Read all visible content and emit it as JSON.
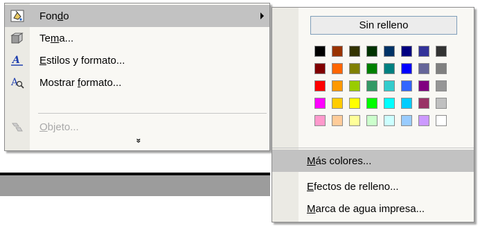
{
  "menu": {
    "items": [
      {
        "pre": "Fon",
        "u": "d",
        "post": "o",
        "icon": "paint-bucket-icon",
        "enabled": true,
        "highlighted": true,
        "has_submenu": true
      },
      {
        "pre": "Te",
        "u": "m",
        "post": "a...",
        "icon": "theme-icon",
        "enabled": true
      },
      {
        "pre": "",
        "u": "E",
        "post": "stilos y formato...",
        "icon": "styles-icon",
        "enabled": true
      },
      {
        "pre": "Mostrar ",
        "u": "f",
        "post": "ormato...",
        "icon": "reveal-formatting-icon",
        "enabled": true
      },
      {
        "pre": "",
        "u": "O",
        "post": "bjeto...",
        "icon": "object-icon",
        "enabled": false
      }
    ],
    "expand_glyph": "»"
  },
  "submenu": {
    "no_fill_label": "Sin relleno",
    "palette": [
      [
        "#000000",
        "#993300",
        "#333300",
        "#003300",
        "#003366",
        "#000080",
        "#333399",
        "#333333"
      ],
      [
        "#800000",
        "#FF6600",
        "#808000",
        "#008000",
        "#008080",
        "#0000FF",
        "#666699",
        "#808080"
      ],
      [
        "#FF0000",
        "#FF9900",
        "#99CC00",
        "#339966",
        "#33CCCC",
        "#3366FF",
        "#800080",
        "#969696"
      ],
      [
        "#FF00FF",
        "#FFCC00",
        "#FFFF00",
        "#00FF00",
        "#00FFFF",
        "#00CCFF",
        "#993366",
        "#C0C0C0"
      ],
      [
        "#FF99CC",
        "#FFCC99",
        "#FFFF99",
        "#CCFFCC",
        "#CCFFFF",
        "#99CCFF",
        "#CC99FF",
        "#FFFFFF"
      ]
    ],
    "items": [
      {
        "pre": "",
        "u": "M",
        "post": "ás colores...",
        "highlighted": true
      },
      {
        "pre": "",
        "u": "E",
        "post": "fectos de relleno..."
      },
      {
        "pre": "",
        "u": "M",
        "post": "arca de agua impresa..."
      }
    ]
  }
}
